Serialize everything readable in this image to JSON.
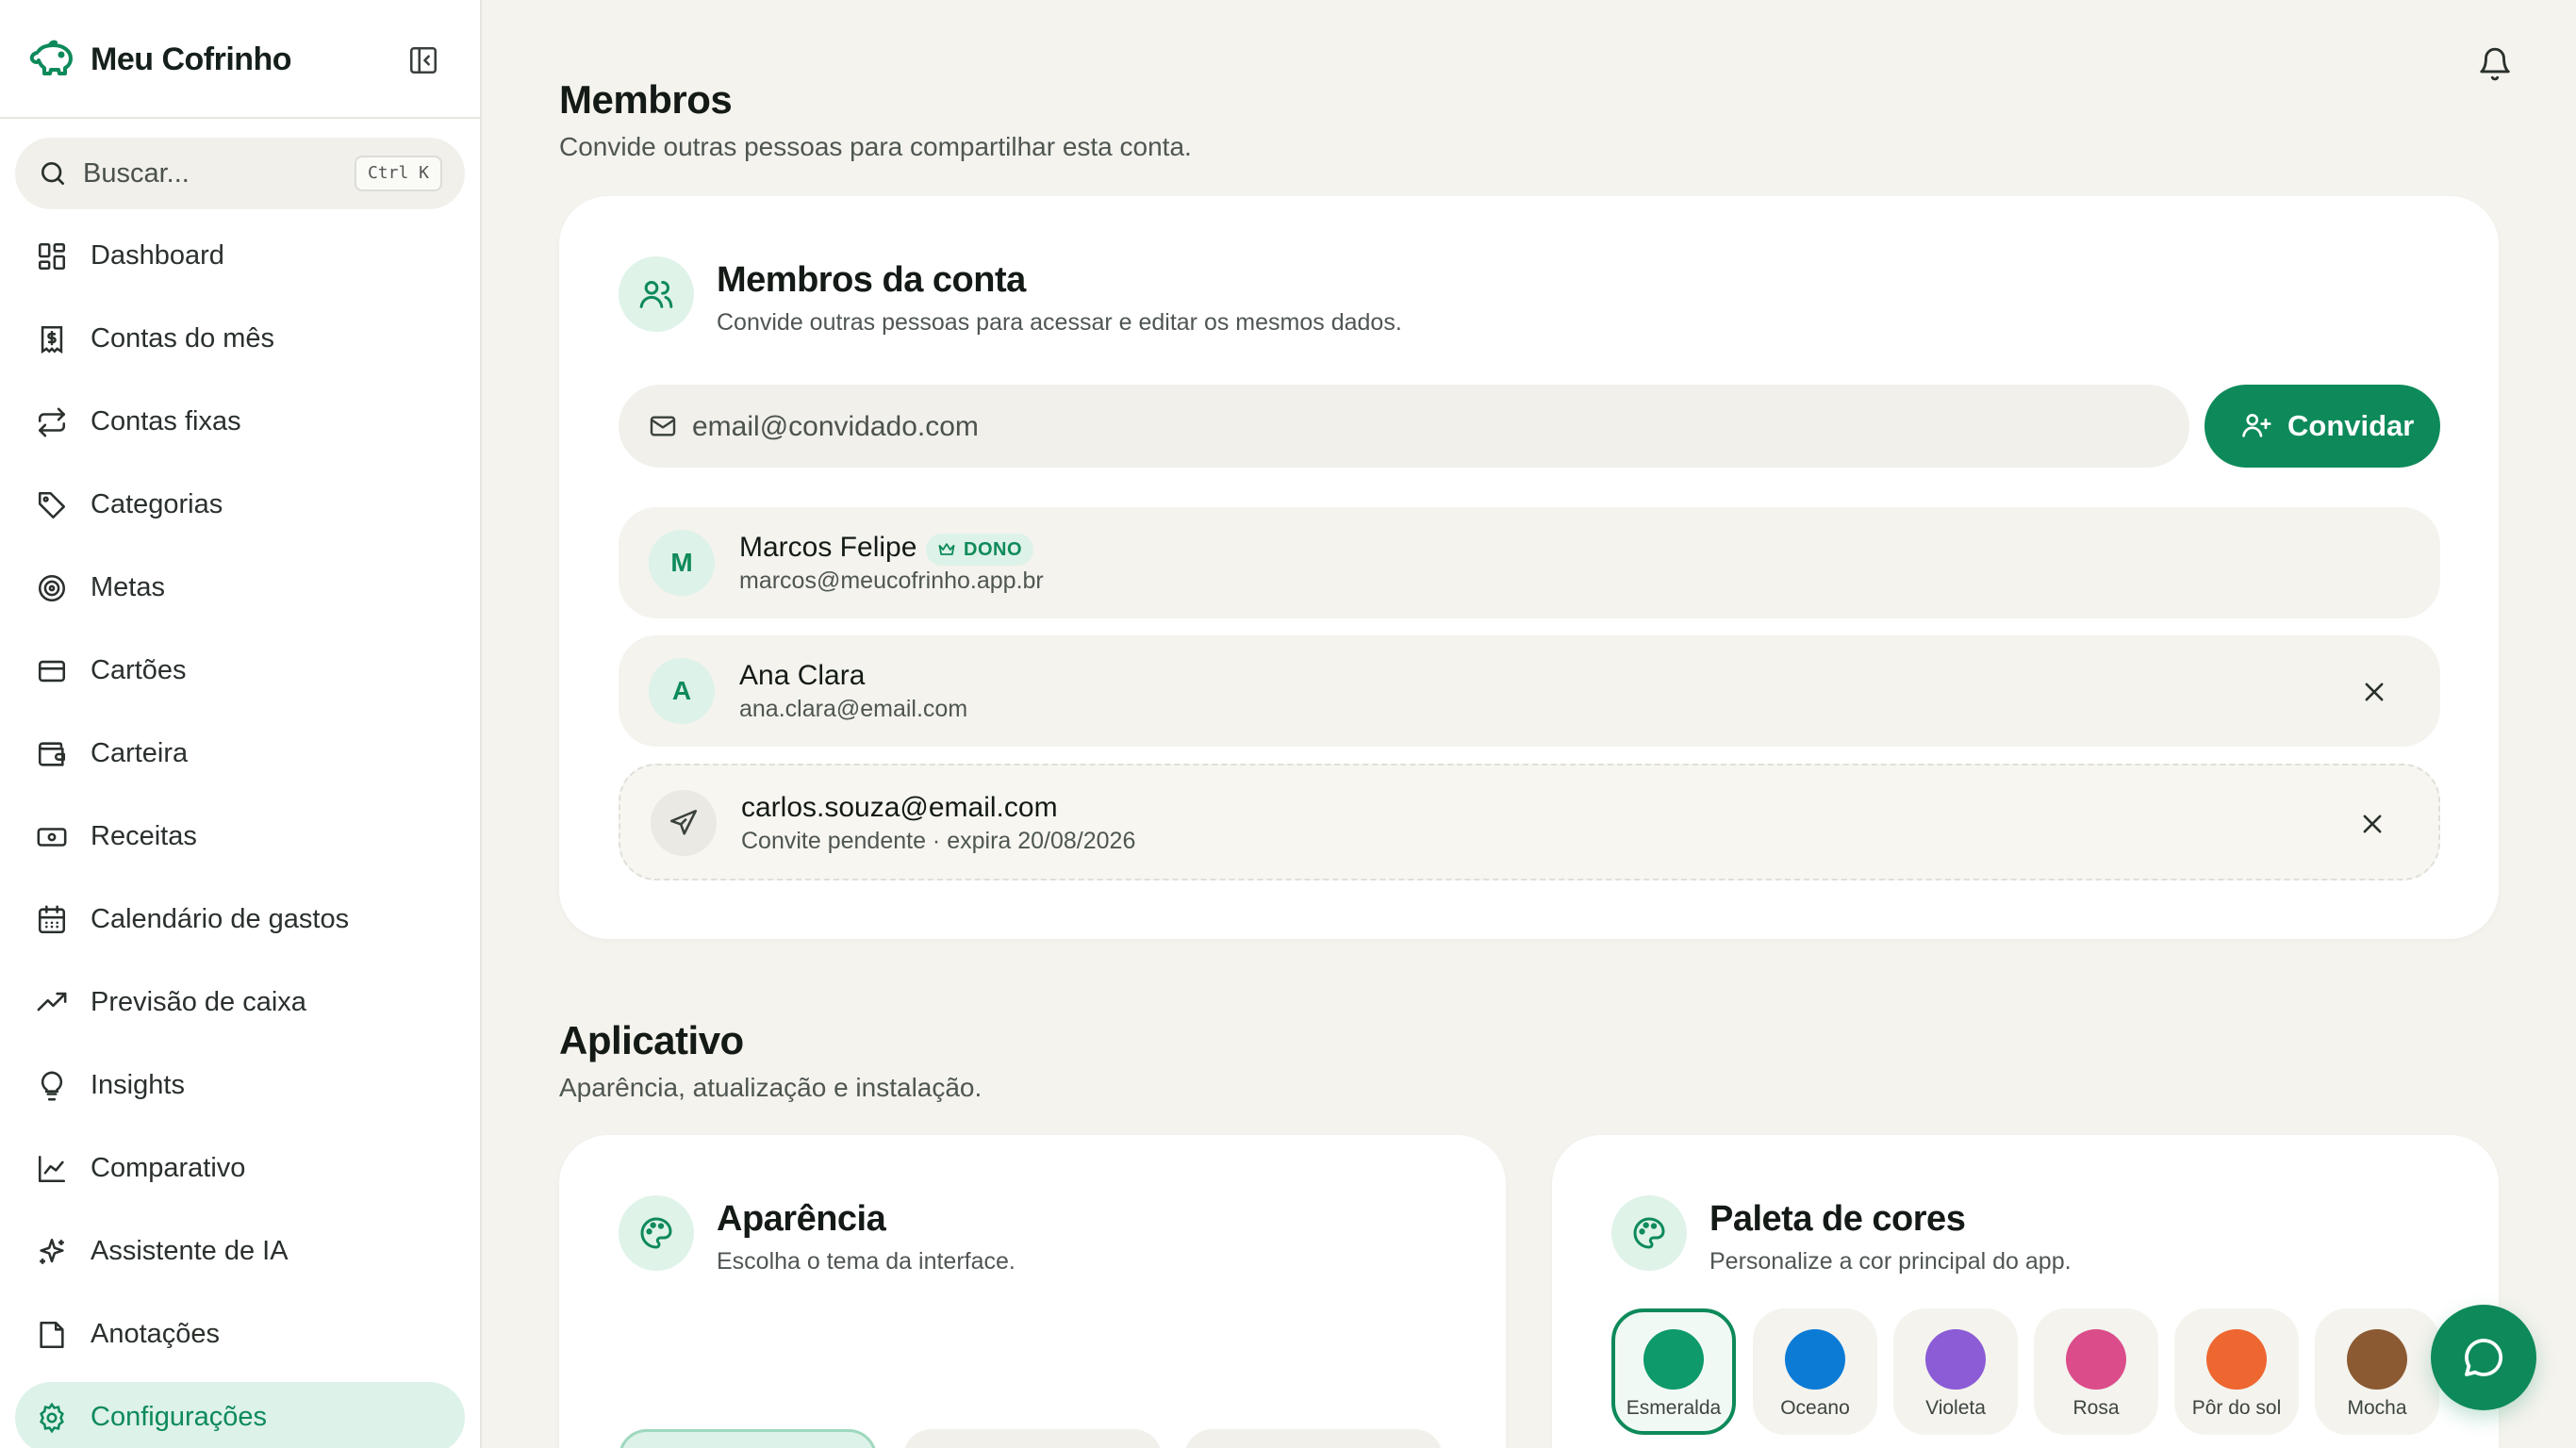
{
  "app": {
    "name": "Meu Cofrinho",
    "brand_color": "#0E8A5A"
  },
  "sidebar": {
    "search": {
      "placeholder": "Buscar...",
      "shortcut": "Ctrl K"
    },
    "items": [
      {
        "label": "Dashboard",
        "icon": "dashboard-grid-icon"
      },
      {
        "label": "Contas do mês",
        "icon": "receipt-icon"
      },
      {
        "label": "Contas fixas",
        "icon": "repeat-icon"
      },
      {
        "label": "Categorias",
        "icon": "tag-icon"
      },
      {
        "label": "Metas",
        "icon": "target-icon"
      },
      {
        "label": "Cartões",
        "icon": "credit-card-icon"
      },
      {
        "label": "Carteira",
        "icon": "wallet-icon"
      },
      {
        "label": "Receitas",
        "icon": "banknote-icon"
      },
      {
        "label": "Calendário de gastos",
        "icon": "calendar-icon"
      },
      {
        "label": "Previsão de caixa",
        "icon": "trending-up-icon"
      },
      {
        "label": "Insights",
        "icon": "lightbulb-icon"
      },
      {
        "label": "Comparativo",
        "icon": "line-chart-icon"
      },
      {
        "label": "Assistente de IA",
        "icon": "sparkles-icon"
      },
      {
        "label": "Anotações",
        "icon": "note-icon"
      },
      {
        "label": "Configurações",
        "icon": "settings-gear-icon",
        "active": true
      }
    ]
  },
  "members_section": {
    "title": "Membros",
    "subtitle": "Convide outras pessoas para compartilhar esta conta.",
    "card": {
      "title": "Membros da conta",
      "subtitle": "Convide outras pessoas para acessar e editar os mesmos dados.",
      "email_placeholder": "email@convidado.com",
      "invite_label": "Convidar"
    },
    "members": [
      {
        "initial": "M",
        "name": "Marcos Felipe",
        "email": "marcos@meucofrinho.app.br",
        "badge": "DONO"
      },
      {
        "initial": "A",
        "name": "Ana Clara",
        "email": "ana.clara@email.com"
      }
    ],
    "pending": {
      "email": "carlos.souza@email.com",
      "status": "Convite pendente · expira 20/08/2026"
    }
  },
  "app_section": {
    "title": "Aplicativo",
    "subtitle": "Aparência, atualização e instalação.",
    "appearance": {
      "title": "Aparência",
      "subtitle": "Escolha o tema da interface."
    },
    "palette": {
      "title": "Paleta de cores",
      "subtitle": "Personalize a cor principal do app.",
      "selected": "Esmeralda",
      "colors": [
        {
          "name": "Esmeralda",
          "hex": "#0E9A6B"
        },
        {
          "name": "Oceano",
          "hex": "#0C7BD6"
        },
        {
          "name": "Violeta",
          "hex": "#8B5CD6"
        },
        {
          "name": "Rosa",
          "hex": "#DB4D8A"
        },
        {
          "name": "Pôr do sol",
          "hex": "#EE6630"
        },
        {
          "name": "Mocha",
          "hex": "#8B5A32"
        }
      ]
    }
  }
}
